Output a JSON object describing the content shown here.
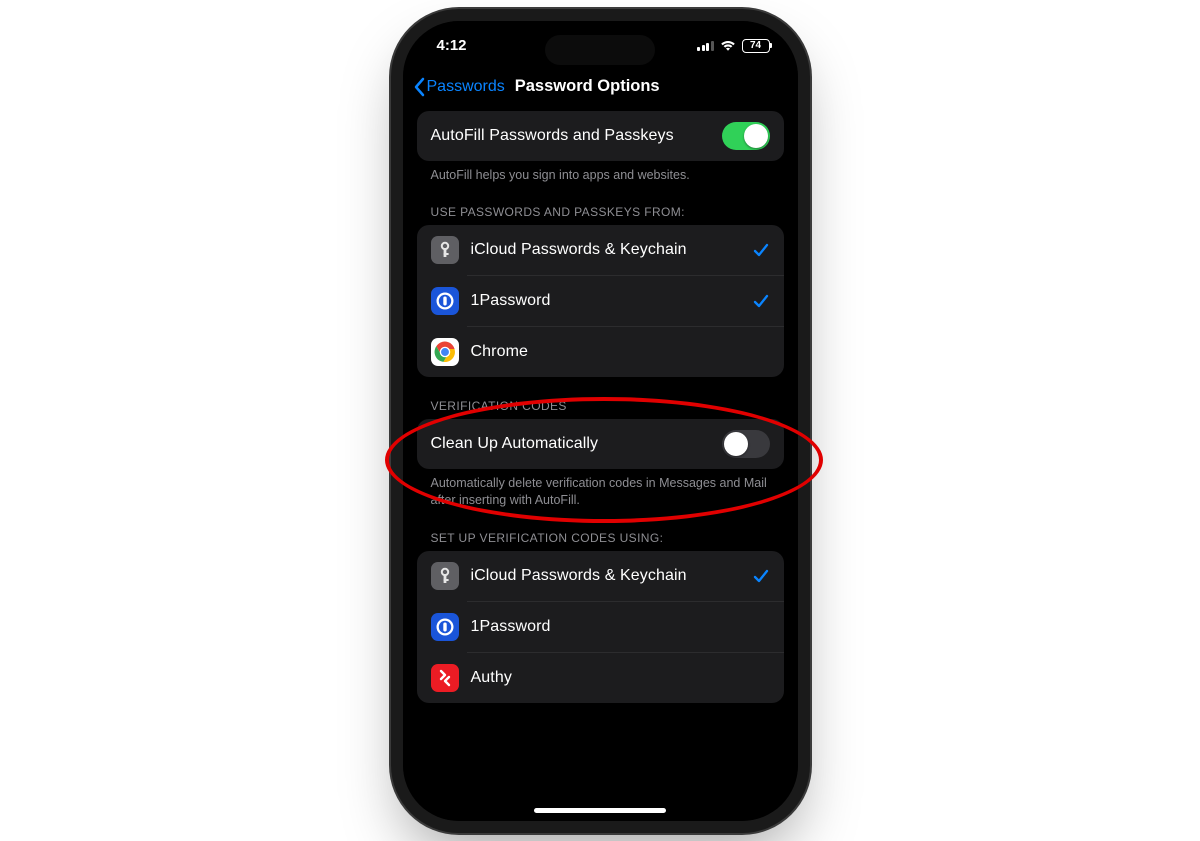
{
  "status": {
    "time": "4:12",
    "battery": "74"
  },
  "nav": {
    "back": "Passwords",
    "title": "Password Options"
  },
  "autofill": {
    "label": "AutoFill Passwords and Passkeys",
    "on": true,
    "footer": "AutoFill helps you sign into apps and websites."
  },
  "sources": {
    "header": "USE PASSWORDS AND PASSKEYS FROM:",
    "items": [
      {
        "label": "iCloud Passwords & Keychain",
        "icon": "keychain",
        "checked": true
      },
      {
        "label": "1Password",
        "icon": "onepassword",
        "checked": true
      },
      {
        "label": "Chrome",
        "icon": "chrome",
        "checked": false
      }
    ]
  },
  "verification": {
    "header": "VERIFICATION CODES",
    "cleanup_label": "Clean Up Automatically",
    "cleanup_on": false,
    "footer": "Automatically delete verification codes in Messages and Mail after inserting with AutoFill."
  },
  "setup": {
    "header": "SET UP VERIFICATION CODES USING:",
    "items": [
      {
        "label": "iCloud Passwords & Keychain",
        "icon": "keychain",
        "checked": true
      },
      {
        "label": "1Password",
        "icon": "onepassword",
        "checked": false
      },
      {
        "label": "Authy",
        "icon": "authy",
        "checked": false
      }
    ]
  }
}
